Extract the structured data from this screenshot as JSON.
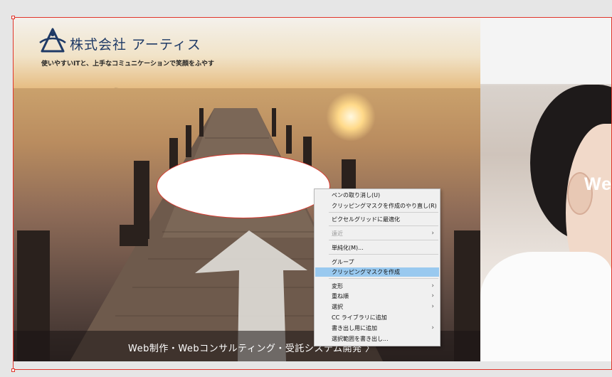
{
  "logo": {
    "company_name": "株式会社 アーティス",
    "tagline": "使いやすいITと、上手なコミュニケーションで笑顔をふやす"
  },
  "banner": {
    "text": "Web制作・Webコンサルティング・受託システム開発  〉"
  },
  "right_photo": {
    "text": "We"
  },
  "context_menu": {
    "items": [
      {
        "label": "ペンの取り消し(U)",
        "enabled": true
      },
      {
        "label": "クリッピングマスクを作成のやり直し(R)",
        "enabled": true
      },
      {
        "label": "ピクセルグリッドに最適化",
        "enabled": true
      },
      {
        "label": "遠近",
        "enabled": false,
        "submenu": true
      },
      {
        "label": "単純化(M)...",
        "enabled": true
      },
      {
        "label": "グループ",
        "enabled": true
      },
      {
        "label": "クリッピングマスクを作成",
        "enabled": true,
        "highlighted": true
      },
      {
        "label": "変形",
        "enabled": true,
        "submenu": true
      },
      {
        "label": "重ね順",
        "enabled": true,
        "submenu": true
      },
      {
        "label": "選択",
        "enabled": true,
        "submenu": true
      },
      {
        "label": "CC ライブラリに追加",
        "enabled": true
      },
      {
        "label": "書き出し用に追加",
        "enabled": true,
        "submenu": true
      },
      {
        "label": "選択範囲を書き出し...",
        "enabled": true
      }
    ],
    "submenu_arrow": "›"
  },
  "colors": {
    "selection": "#e0352b",
    "menu_highlight": "#99c9ef",
    "logo_blue": "#1f3a66"
  }
}
